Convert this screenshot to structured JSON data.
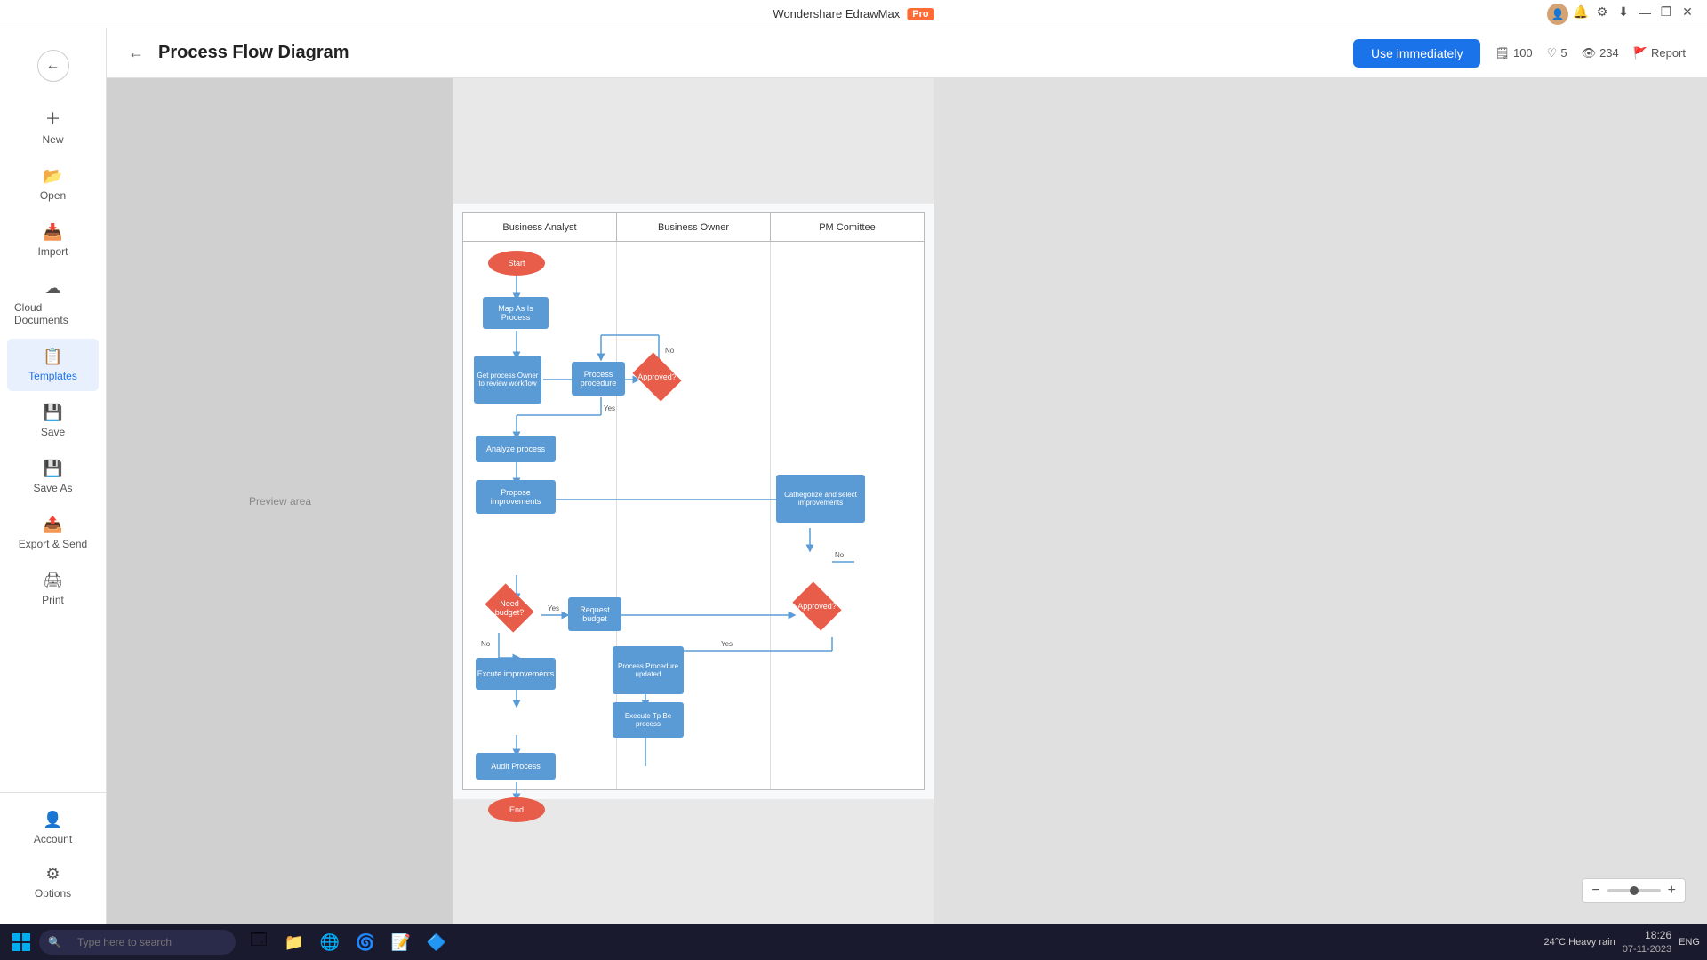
{
  "app": {
    "title": "Wondershare EdrawMax",
    "pro_badge": "Pro"
  },
  "window_controls": {
    "minimize": "—",
    "maximize": "❐",
    "close": "✕"
  },
  "toolbar_icons": [
    "🔔",
    "☰",
    "⬇"
  ],
  "sidebar": {
    "back_icon": "←",
    "items": [
      {
        "id": "new",
        "label": "New",
        "icon": "+"
      },
      {
        "id": "open",
        "label": "Open",
        "icon": "📂"
      },
      {
        "id": "import",
        "label": "Import",
        "icon": "📥"
      },
      {
        "id": "cloud",
        "label": "Cloud Documents",
        "icon": "☁"
      },
      {
        "id": "templates",
        "label": "Templates",
        "icon": "📋"
      },
      {
        "id": "save",
        "label": "Save",
        "icon": "💾"
      },
      {
        "id": "saveas",
        "label": "Save As",
        "icon": "💾"
      },
      {
        "id": "export",
        "label": "Export & Send",
        "icon": "📤"
      },
      {
        "id": "print",
        "label": "Print",
        "icon": "🖨"
      }
    ],
    "bottom_items": [
      {
        "id": "account",
        "label": "Account",
        "icon": "👤"
      },
      {
        "id": "options",
        "label": "Options",
        "icon": "⚙"
      }
    ]
  },
  "page": {
    "title": "Process Flow Diagram",
    "back_icon": "←"
  },
  "actions": {
    "use_immediately": "Use immediately"
  },
  "stats": {
    "copy_icon": "📋",
    "copy_count": "100",
    "like_icon": "♡",
    "like_count": "5",
    "view_icon": "👁",
    "view_count": "234",
    "report_icon": "🚩",
    "report_label": "Report"
  },
  "swimlane": {
    "columns": [
      "Business Analyst",
      "Business Owner",
      "PM Comittee"
    ]
  },
  "zoom": {
    "minus": "−",
    "plus": "+",
    "value": "—"
  },
  "taskbar": {
    "search_placeholder": "Type here to search",
    "apps": [
      "⊞",
      "🔍",
      "🗔",
      "📁",
      "🌐",
      "🌀",
      "📝",
      "🔷"
    ],
    "weather": "24°C  Heavy rain",
    "time": "18:26",
    "date": "07-11-2023",
    "language": "ENG"
  }
}
